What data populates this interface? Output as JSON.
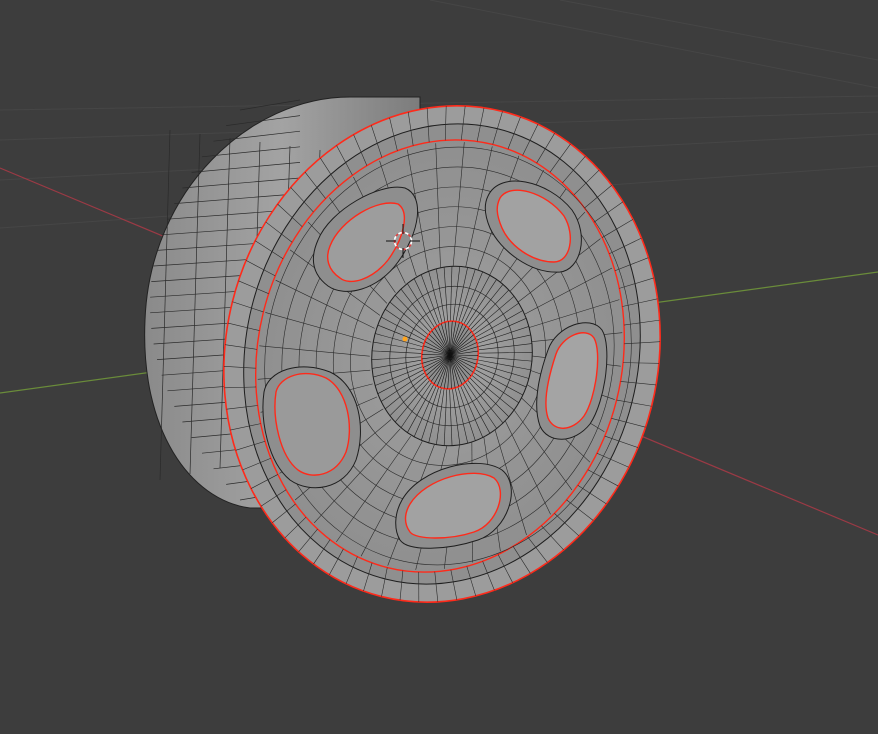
{
  "app": {
    "name": "3D Viewport",
    "mode": "edit-mode-mesh"
  },
  "viewport": {
    "background_color": "#3d3d3d",
    "grid_color": "#4a4a4a",
    "x_axis_color": "#9b3a45",
    "y_axis_color": "#6a8c3a"
  },
  "mesh": {
    "object": "wheel-rim",
    "base_color": "#9a9a9a",
    "wire_color": "#1e1e1e",
    "selected_edge_color": "#ff2a1a",
    "spoke_hole_count": 5
  },
  "cursor": {
    "type": "3d-cursor",
    "ring_colors": [
      "#ffffff",
      "#e04040"
    ]
  },
  "origin": {
    "type": "object-origin",
    "color": "#ffa51f"
  }
}
